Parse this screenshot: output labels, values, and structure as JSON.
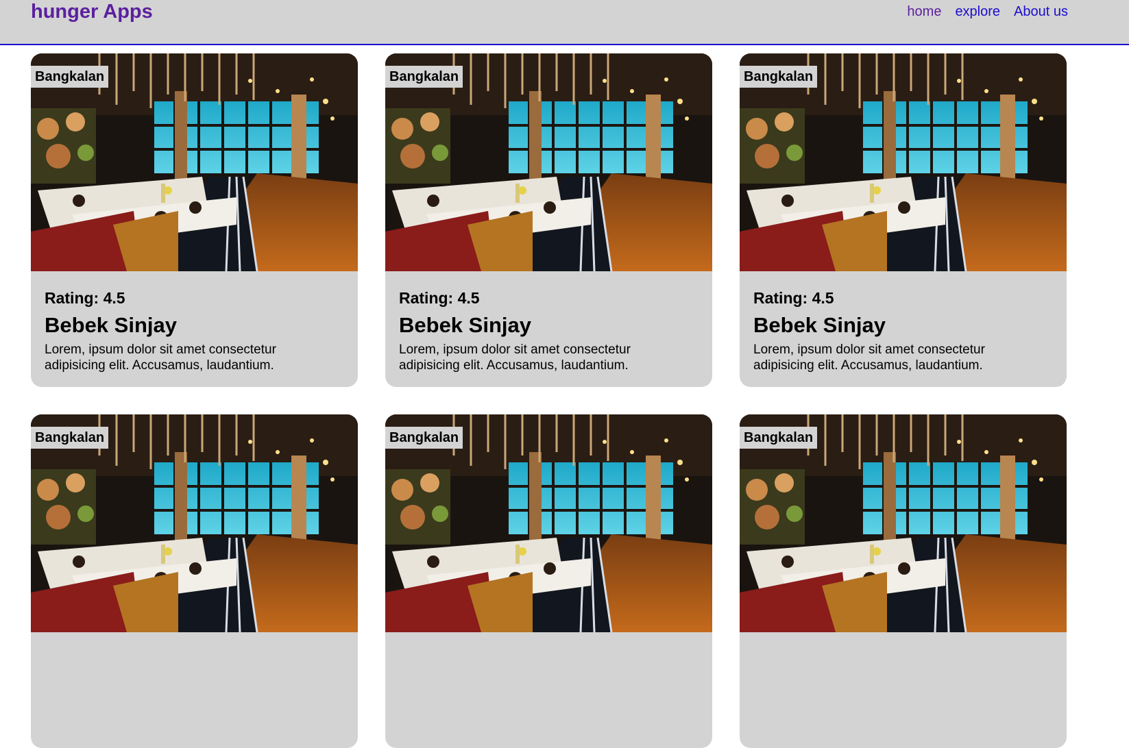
{
  "header": {
    "brand": "hunger Apps",
    "nav": [
      {
        "label": "home",
        "state": "visited"
      },
      {
        "label": "explore",
        "state": "link"
      },
      {
        "label": "About us",
        "state": "link"
      }
    ]
  },
  "colors": {
    "header_bg": "#d3d3d3",
    "brand": "#5b1f9e",
    "link": "#1a0dcc",
    "card_bg": "#d3d3d3"
  },
  "restaurants": [
    {
      "city": "Bangkalan",
      "rating": "Rating: 4.5",
      "name": "Bebek Sinjay",
      "description": "Lorem, ipsum dolor sit amet consectetur adipisicing elit. Accusamus, laudantium.",
      "image": "restaurant-interior-photo"
    },
    {
      "city": "Bangkalan",
      "rating": "Rating: 4.5",
      "name": "Bebek Sinjay",
      "description": "Lorem, ipsum dolor sit amet consectetur adipisicing elit. Accusamus, laudantium.",
      "image": "restaurant-interior-photo"
    },
    {
      "city": "Bangkalan",
      "rating": "Rating: 4.5",
      "name": "Bebek Sinjay",
      "description": "Lorem, ipsum dolor sit amet consectetur adipisicing elit. Accusamus, laudantium.",
      "image": "restaurant-interior-photo"
    },
    {
      "city": "Bangkalan",
      "rating": "",
      "name": "",
      "description": "",
      "image": "restaurant-interior-photo"
    },
    {
      "city": "Bangkalan",
      "rating": "",
      "name": "",
      "description": "",
      "image": "restaurant-interior-photo"
    },
    {
      "city": "Bangkalan",
      "rating": "",
      "name": "",
      "description": "",
      "image": "restaurant-interior-photo"
    }
  ]
}
